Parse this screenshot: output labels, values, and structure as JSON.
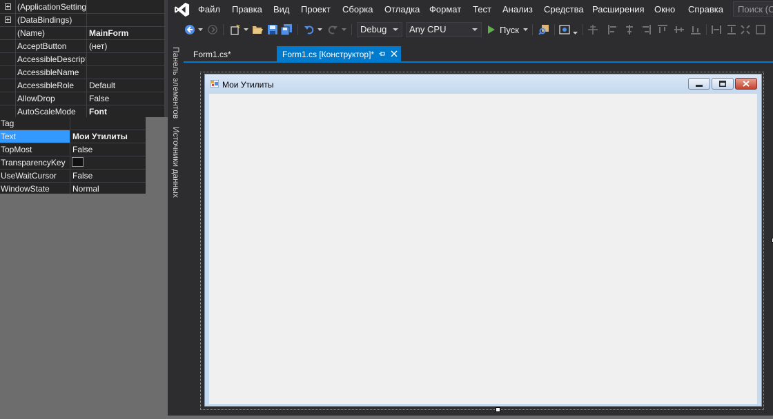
{
  "menu": {
    "items": [
      "Файл",
      "Правка",
      "Вид",
      "Проект",
      "Сборка",
      "Отладка",
      "Формат",
      "Тест",
      "Анализ",
      "Средства",
      "Расширения",
      "Окно",
      "Справка"
    ],
    "search_placeholder": "Поиск (Ctrl+Q)"
  },
  "toolbar": {
    "configuration": "Debug",
    "platform": "Any CPU",
    "start_label": "Пуск"
  },
  "side_tabs": {
    "toolbox": "Панель элементов",
    "data_sources": "Источники данных"
  },
  "doc_tabs": {
    "code_tab": "Form1.cs*",
    "designer_tab": "Form1.cs [Конструктор]*",
    "pin_icon": "pin-icon",
    "close_icon": "close-icon"
  },
  "form": {
    "title": "Мои Утилиты"
  },
  "properties_top": [
    {
      "name": "(ApplicationSettings)",
      "value": "",
      "expandable": true,
      "bold_value": false
    },
    {
      "name": "(DataBindings)",
      "value": "",
      "expandable": true,
      "bold_value": false
    },
    {
      "name": "(Name)",
      "value": "MainForm",
      "expandable": false,
      "bold_value": true
    },
    {
      "name": "AcceptButton",
      "value": "(нет)",
      "expandable": false,
      "bold_value": false
    },
    {
      "name": "AccessibleDescription",
      "value": "",
      "expandable": false,
      "bold_value": false
    },
    {
      "name": "AccessibleName",
      "value": "",
      "expandable": false,
      "bold_value": false
    },
    {
      "name": "AccessibleRole",
      "value": "Default",
      "expandable": false,
      "bold_value": false
    },
    {
      "name": "AllowDrop",
      "value": "False",
      "expandable": false,
      "bold_value": false
    },
    {
      "name": "AutoScaleMode",
      "value": "Font",
      "expandable": false,
      "bold_value": true
    }
  ],
  "properties_bottom": [
    {
      "name": "Tag",
      "value": ""
    },
    {
      "name": "Text",
      "value": "Мои Утилиты"
    },
    {
      "name": "TopMost",
      "value": "False"
    },
    {
      "name": "TransparencyKey",
      "value": ""
    },
    {
      "name": "UseWaitCursor",
      "value": "False"
    },
    {
      "name": "WindowState",
      "value": "Normal"
    }
  ],
  "colors": {
    "vs_background": "#2d2d30",
    "accent": "#007acc",
    "selection": "#3399ff",
    "desktop": "#6d6d6d"
  }
}
